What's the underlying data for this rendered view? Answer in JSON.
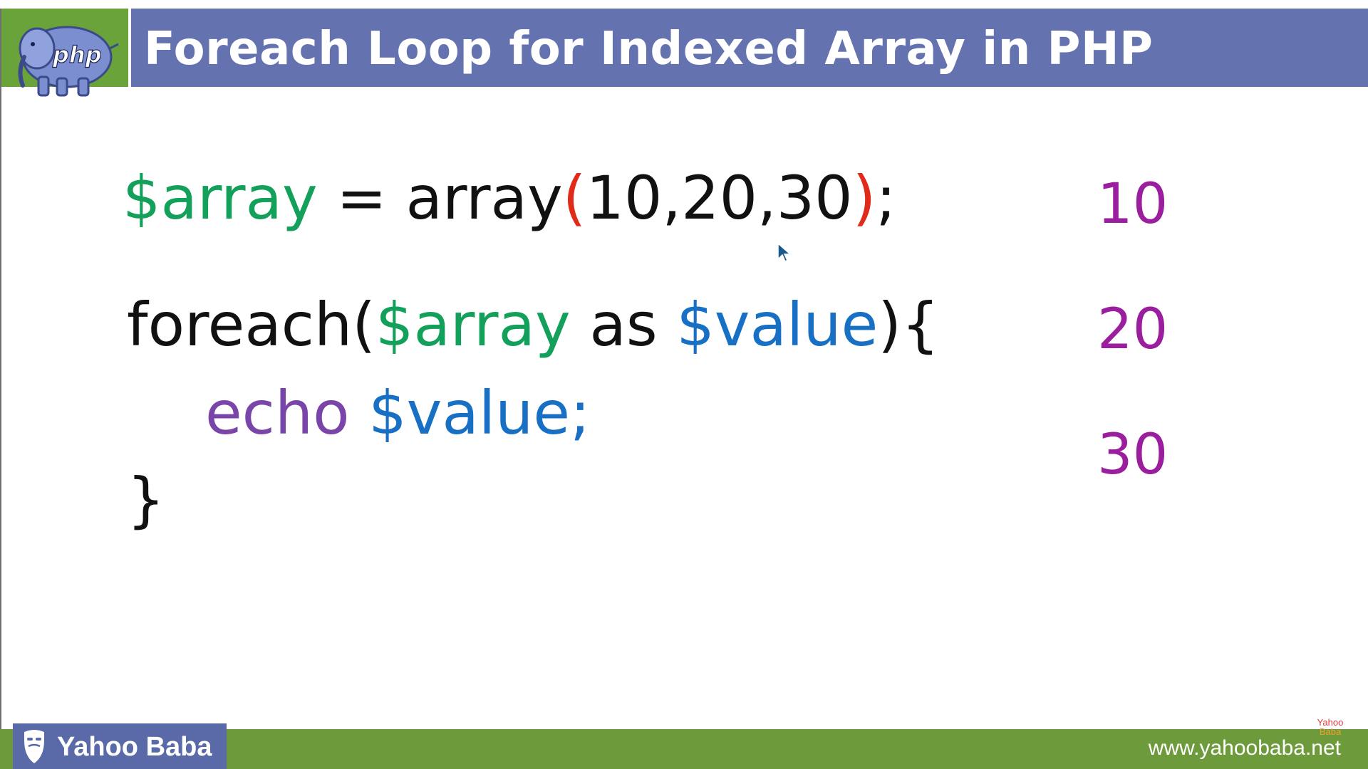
{
  "header": {
    "title": "Foreach Loop for Indexed Array in PHP",
    "logo_text": "php"
  },
  "code": {
    "line1": {
      "var": "$array",
      "assign": " = array",
      "open_paren": "(",
      "values": "10,20,30",
      "close_paren": ")",
      "end": ";"
    },
    "line2": {
      "keyword": "foreach(",
      "var": "$array",
      "as": " as ",
      "value_var": "$value",
      "close": "){"
    },
    "line3": {
      "keyword": "echo ",
      "value_var": "$value;"
    },
    "line4": {
      "brace": "}"
    }
  },
  "output": [
    "10",
    "20",
    "30"
  ],
  "footer": {
    "brand": "Yahoo Baba",
    "website": "www.yahoobaba.net",
    "watermark_line1": "Yahoo",
    "watermark_line2": "Baba"
  },
  "colors": {
    "title_bar": "#6472b0",
    "logo_bg": "#6aa33a",
    "footer_bar": "#6d9a3a",
    "variable": "#12a05a",
    "value_var": "#1870c4",
    "keyword_echo": "#7a45a8",
    "paren": "#e02a1a",
    "output": "#9a1e9e"
  }
}
